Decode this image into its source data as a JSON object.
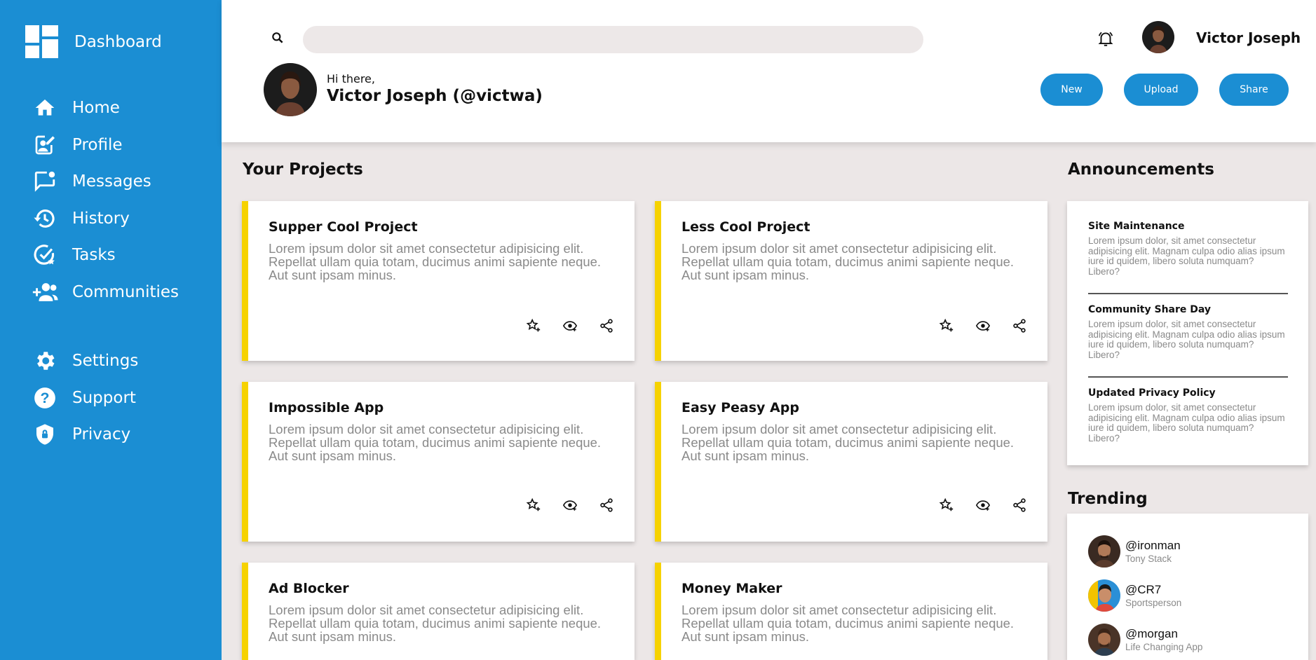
{
  "app": {
    "title": "Dashboard"
  },
  "sidebar": {
    "items": [
      {
        "label": "Home",
        "icon": "home-icon"
      },
      {
        "label": "Profile",
        "icon": "profile-edit-icon"
      },
      {
        "label": "Messages",
        "icon": "messages-icon"
      },
      {
        "label": "History",
        "icon": "history-icon"
      },
      {
        "label": "Tasks",
        "icon": "tasks-icon"
      },
      {
        "label": "Communities",
        "icon": "communities-icon"
      }
    ],
    "bottom_items": [
      {
        "label": "Settings",
        "icon": "gear-icon"
      },
      {
        "label": "Support",
        "icon": "help-icon"
      },
      {
        "label": "Privacy",
        "icon": "shield-icon"
      }
    ]
  },
  "header": {
    "search": {
      "placeholder": "",
      "value": ""
    },
    "user_name": "Victor Joseph",
    "greeting": "Hi there,",
    "handle": "Victor Joseph (@victwa)",
    "buttons": {
      "new": "New",
      "upload": "Upload",
      "share": "Share"
    }
  },
  "projects": {
    "title": "Your Projects",
    "items": [
      {
        "title": "Supper Cool Project",
        "desc": "Lorem ipsum dolor sit amet consectetur adipisicing elit. Repellat ullam quia totam, ducimus animi sapiente neque. Aut sunt ipsam minus."
      },
      {
        "title": "Less Cool Project",
        "desc": "Lorem ipsum dolor sit amet consectetur adipisicing elit. Repellat ullam quia totam, ducimus animi sapiente neque. Aut sunt ipsam minus."
      },
      {
        "title": "Impossible App",
        "desc": "Lorem ipsum dolor sit amet consectetur adipisicing elit. Repellat ullam quia totam, ducimus animi sapiente neque. Aut sunt ipsam minus."
      },
      {
        "title": "Easy Peasy App",
        "desc": "Lorem ipsum dolor sit amet consectetur adipisicing elit. Repellat ullam quia totam, ducimus animi sapiente neque. Aut sunt ipsam minus."
      },
      {
        "title": "Ad Blocker",
        "desc": "Lorem ipsum dolor sit amet consectetur adipisicing elit. Repellat ullam quia totam, ducimus animi sapiente neque. Aut sunt ipsam minus."
      },
      {
        "title": "Money Maker",
        "desc": "Lorem ipsum dolor sit amet consectetur adipisicing elit. Repellat ullam quia totam, ducimus animi sapiente neque. Aut sunt ipsam minus."
      }
    ]
  },
  "announcements": {
    "title": "Announcements",
    "items": [
      {
        "title": "Site Maintenance",
        "text": "Lorem ipsum dolor, sit amet consectetur adipisicing elit. Magnam culpa odio alias ipsum iure id quidem, libero soluta numquam? Libero?"
      },
      {
        "title": "Community Share Day",
        "text": "Lorem ipsum dolor, sit amet consectetur adipisicing elit. Magnam culpa odio alias ipsum iure id quidem, libero soluta numquam? Libero?"
      },
      {
        "title": "Updated Privacy Policy",
        "text": "Lorem ipsum dolor, sit amet consectetur adipisicing elit. Magnam culpa odio alias ipsum iure id quidem, libero soluta numquam? Libero?"
      }
    ]
  },
  "trending": {
    "title": "Trending",
    "items": [
      {
        "handle": "@ironman",
        "name": "Tony Stack"
      },
      {
        "handle": "@CR7",
        "name": "Sportsperson"
      },
      {
        "handle": "@morgan",
        "name": "Life Changing App"
      }
    ]
  },
  "colors": {
    "primary": "#1b8ed3",
    "accent": "#f6d200",
    "background": "#ece7e7"
  }
}
